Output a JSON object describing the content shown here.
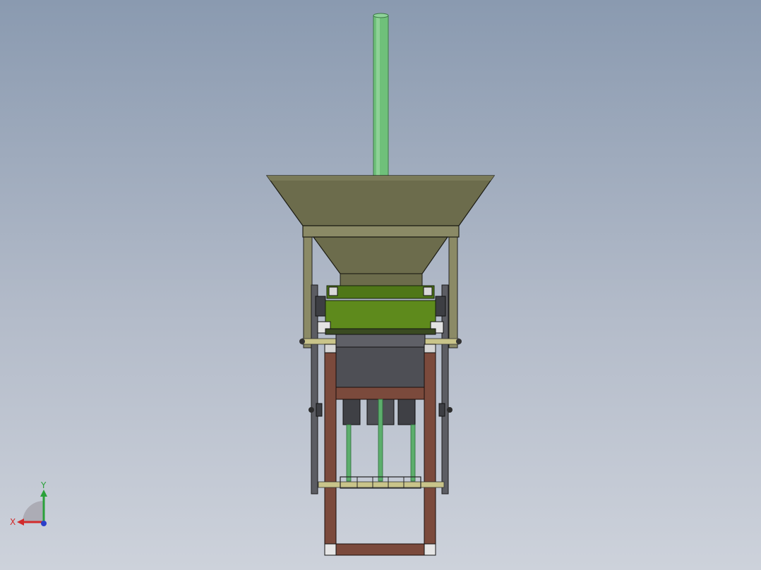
{
  "colors": {
    "background_top": "#8a9ab0",
    "background_bottom": "#cdd2db",
    "pipe_green": "#6fc07a",
    "hopper_olive": "#6c6c4c",
    "hopper_olive_light": "#8b8a66",
    "feeder_green": "#5e8a1c",
    "frame_brown": "#7b4a3c",
    "housing_gray": "#4e4f55",
    "rod_green": "#5cae6c",
    "axis_x": "#d22b2b",
    "axis_y": "#2aa13a",
    "axis_z": "#2b3fc9"
  },
  "triad": {
    "x_label": "X",
    "y_label": "Y"
  }
}
